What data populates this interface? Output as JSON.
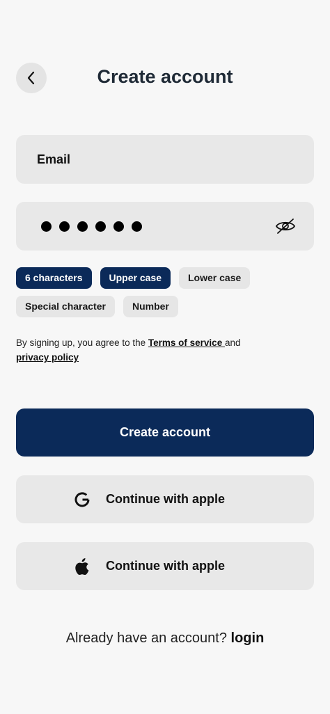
{
  "header": {
    "title": "Create account",
    "back_icon": "chevron-left-icon"
  },
  "form": {
    "email_placeholder": "Email",
    "password_dot_count": 6,
    "password_toggle_icon": "eye-off-icon"
  },
  "requirements": [
    {
      "label": "6 characters",
      "met": true
    },
    {
      "label": "Upper case",
      "met": true
    },
    {
      "label": "Lower case",
      "met": false
    },
    {
      "label": "Special character",
      "met": false
    },
    {
      "label": "Number",
      "met": false
    }
  ],
  "terms": {
    "prefix": "By signing up, you agree to the ",
    "terms_link": "Terms of service ",
    "middle": "and",
    "privacy_link": "privacy policy"
  },
  "buttons": {
    "create_account": "Create account",
    "google_label": "Continue with apple",
    "google_icon": "google-icon",
    "apple_label": "Continue with apple",
    "apple_icon": "apple-icon"
  },
  "footer": {
    "prompt": "Already have an account? ",
    "login_link": "login"
  },
  "colors": {
    "primary": "#0b2a59",
    "field_bg": "#e8e8e8",
    "page_bg": "#f7f7f7"
  }
}
